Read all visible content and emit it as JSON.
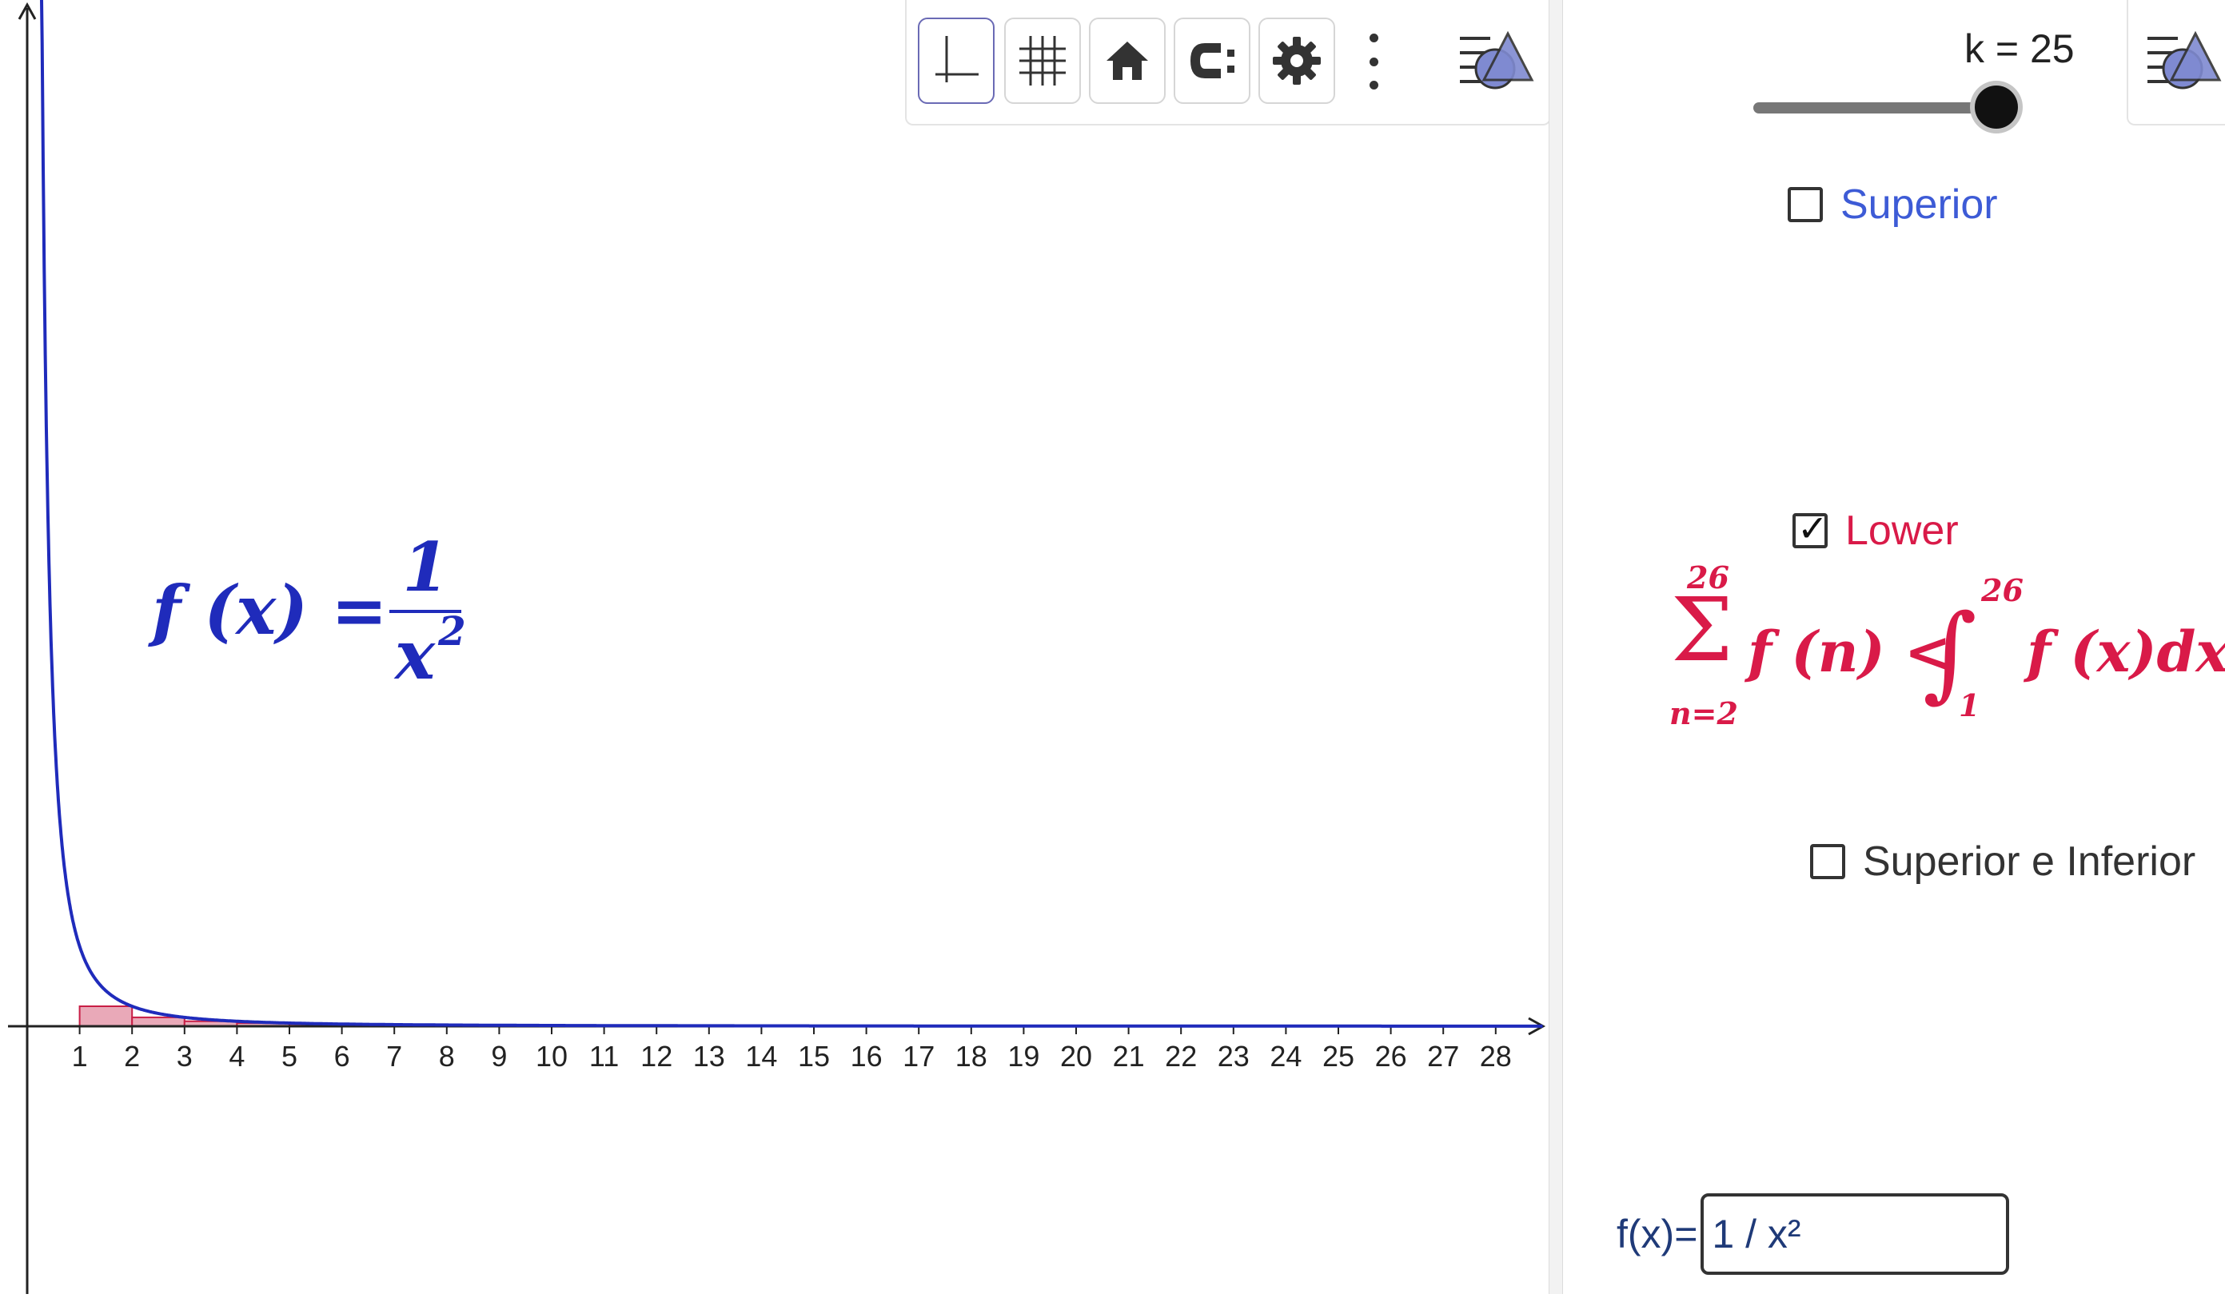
{
  "graphics": {
    "formula": {
      "lhs": "f (x) =",
      "numerator": "1",
      "denominator": "x",
      "exponent": "2"
    },
    "axis": {
      "x_ticks": [
        "1",
        "2",
        "3",
        "4",
        "5",
        "6",
        "7",
        "8",
        "9",
        "10",
        "11",
        "12",
        "13",
        "14",
        "15",
        "16",
        "17",
        "18",
        "19",
        "20",
        "21",
        "22",
        "23",
        "24",
        "25",
        "26",
        "27",
        "28"
      ]
    }
  },
  "toolbar": {
    "icons": [
      "axes-icon",
      "grid-icon",
      "home-icon",
      "magnet-icon",
      "gear-icon",
      "more-icon",
      "style-bar-icon"
    ]
  },
  "panel": {
    "slider": {
      "label": "k = 25",
      "value": 25
    },
    "checkboxes": {
      "superior": {
        "label": "Superior",
        "checked": false,
        "color": "#3d5bd6"
      },
      "lower": {
        "label": "Lower",
        "checked": true,
        "color": "#d91a48"
      },
      "superior_inferior": {
        "label": "Superior e Inferior",
        "checked": false,
        "color": "#333333"
      }
    },
    "sum_formula": {
      "upper": "26",
      "lower": "n=2",
      "summand": "f (n) <",
      "int_upper": "26",
      "int_lower": "1",
      "integrand": "f (x)dx"
    },
    "input": {
      "label": "f(x)=",
      "value": "1 / x²"
    }
  },
  "colors": {
    "curve": "#1f2bbb",
    "bars_fill": "#e9a9b8",
    "bars_stroke": "#c81e45",
    "formula_blue": "#1f2bbb",
    "formula_red": "#d91a48"
  }
}
